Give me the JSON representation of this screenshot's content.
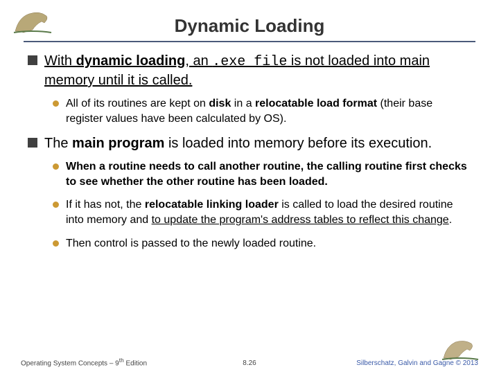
{
  "title": "Dynamic Loading",
  "bullets": {
    "b1_pre": "With ",
    "b1_bold": "dynamic loading",
    "b1_mid": ", an ",
    "b1_mono": ".exe file",
    "b1_post": " is not loaded into main memory until it is called.",
    "b1a_pre": "All of its routines are kept on ",
    "b1a_bold1": "disk",
    "b1a_mid": " in a ",
    "b1a_bold2": "relocatable load format",
    "b1a_post": " (their base register values have been calculated by OS).",
    "b2_pre": "The ",
    "b2_bold": "main program",
    "b2_post": " is loaded into memory before its execution.",
    "b2a": "When a routine needs to call another routine, the calling routine first checks to see whether the other routine has been loaded.",
    "b2b_pre": "If it has not, the ",
    "b2b_bold": "relocatable linking loader",
    "b2b_mid": " is called to load the desired routine into memory and ",
    "b2b_ul": "to update the program's address tables to reflect this change",
    "b2b_post": ".",
    "b2c": "Then control is passed to the newly loaded routine."
  },
  "footer": {
    "left_pre": "Operating System Concepts – 9",
    "left_sup": "th",
    "left_post": " Edition",
    "center": "8.26",
    "right": "Silberschatz, Galvin and Gagne © 2013"
  }
}
